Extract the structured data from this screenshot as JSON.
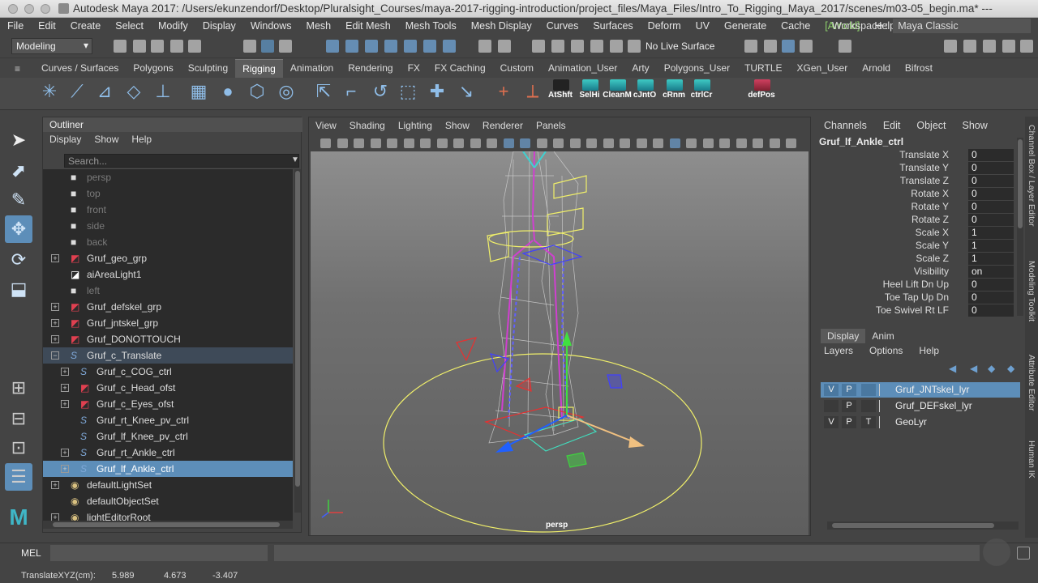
{
  "window": {
    "title": "Autodesk Maya 2017: /Users/ekunzendorf/Desktop/Pluralsight_Courses/maya-2017-rigging-introduction/project_files/Maya_Files/Intro_To_Rigging_Maya_2017/scenes/m03-05_begin.ma* ---"
  },
  "menu": [
    "File",
    "Edit",
    "Create",
    "Select",
    "Modify",
    "Display",
    "Windows",
    "Mesh",
    "Edit Mesh",
    "Mesh Tools",
    "Mesh Display",
    "Curves",
    "Surfaces",
    "Deform",
    "UV",
    "Generate",
    "Cache",
    "[Arnold]",
    "Help"
  ],
  "workspace": {
    "label": "Workspace :",
    "value": "Maya Classic"
  },
  "statusline": {
    "mode": "Modeling",
    "live_surface": "No Live Surface"
  },
  "shelf_tabs": [
    "Curves / Surfaces",
    "Polygons",
    "Sculpting",
    "Rigging",
    "Animation",
    "Rendering",
    "FX",
    "FX Caching",
    "Custom",
    "Animation_User",
    "Arty",
    "Polygons_User",
    "TURTLE",
    "XGen_User",
    "Arnold",
    "Bifrost"
  ],
  "shelf_active": "Rigging",
  "shelf_labels": [
    "AtShft",
    "SelHi",
    "CleanM",
    "cJntO",
    "cRnm",
    "ctrlCr",
    "defPos"
  ],
  "outliner": {
    "title": "Outliner",
    "menu": [
      "Display",
      "Show",
      "Help"
    ],
    "search_placeholder": "Search...",
    "items": [
      {
        "label": "persp",
        "indent": 0,
        "icon": "camera",
        "expand": false,
        "state": "grey"
      },
      {
        "label": "top",
        "indent": 0,
        "icon": "camera",
        "expand": false,
        "state": "grey"
      },
      {
        "label": "front",
        "indent": 0,
        "icon": "camera",
        "expand": false,
        "state": "grey"
      },
      {
        "label": "side",
        "indent": 0,
        "icon": "camera",
        "expand": false,
        "state": "grey"
      },
      {
        "label": "back",
        "indent": 0,
        "icon": "camera",
        "expand": false,
        "state": "grey"
      },
      {
        "label": "Gruf_geo_grp",
        "indent": 0,
        "icon": "group",
        "expand": true,
        "state": ""
      },
      {
        "label": "aiAreaLight1",
        "indent": 0,
        "icon": "light",
        "expand": false,
        "state": ""
      },
      {
        "label": "left",
        "indent": 0,
        "icon": "camera",
        "expand": false,
        "state": "grey"
      },
      {
        "label": "Gruf_defskel_grp",
        "indent": 0,
        "icon": "group",
        "expand": true,
        "state": ""
      },
      {
        "label": "Gruf_jntskel_grp",
        "indent": 0,
        "icon": "group",
        "expand": true,
        "state": ""
      },
      {
        "label": "Gruf_DONOTTOUCH",
        "indent": 0,
        "icon": "group",
        "expand": true,
        "state": ""
      },
      {
        "label": "Gruf_c_Translate",
        "indent": 0,
        "icon": "curve",
        "expand": "open",
        "state": "hilite"
      },
      {
        "label": "Gruf_c_COG_ctrl",
        "indent": 1,
        "icon": "curve",
        "expand": true,
        "state": ""
      },
      {
        "label": "Gruf_c_Head_ofst",
        "indent": 1,
        "icon": "group",
        "expand": true,
        "state": ""
      },
      {
        "label": "Gruf_c_Eyes_ofst",
        "indent": 1,
        "icon": "group",
        "expand": true,
        "state": ""
      },
      {
        "label": "Gruf_rt_Knee_pv_ctrl",
        "indent": 1,
        "icon": "curve",
        "expand": false,
        "state": ""
      },
      {
        "label": "Gruf_lf_Knee_pv_ctrl",
        "indent": 1,
        "icon": "curve",
        "expand": false,
        "state": ""
      },
      {
        "label": "Gruf_rt_Ankle_ctrl",
        "indent": 1,
        "icon": "curve",
        "expand": true,
        "state": ""
      },
      {
        "label": "Gruf_lf_Ankle_ctrl",
        "indent": 1,
        "icon": "curve",
        "expand": true,
        "state": "sel"
      },
      {
        "label": "defaultLightSet",
        "indent": 0,
        "icon": "set",
        "expand": true,
        "state": ""
      },
      {
        "label": "defaultObjectSet",
        "indent": 0,
        "icon": "set",
        "expand": false,
        "state": ""
      },
      {
        "label": "lightEditorRoot",
        "indent": 0,
        "icon": "set",
        "expand": true,
        "state": ""
      }
    ]
  },
  "viewport": {
    "menu": [
      "View",
      "Shading",
      "Lighting",
      "Show",
      "Renderer",
      "Panels"
    ],
    "camera": "persp"
  },
  "channel_box": {
    "menu": [
      "Channels",
      "Edit",
      "Object",
      "Show"
    ],
    "node": "Gruf_lf_Ankle_ctrl",
    "channels": [
      {
        "name": "Translate X",
        "value": "0"
      },
      {
        "name": "Translate Y",
        "value": "0"
      },
      {
        "name": "Translate Z",
        "value": "0"
      },
      {
        "name": "Rotate X",
        "value": "0"
      },
      {
        "name": "Rotate Y",
        "value": "0"
      },
      {
        "name": "Rotate Z",
        "value": "0"
      },
      {
        "name": "Scale X",
        "value": "1"
      },
      {
        "name": "Scale Y",
        "value": "1"
      },
      {
        "name": "Scale Z",
        "value": "1"
      },
      {
        "name": "Visibility",
        "value": "on"
      },
      {
        "name": "Heel Lift Dn Up",
        "value": "0"
      },
      {
        "name": "Toe Tap Up Dn",
        "value": "0"
      },
      {
        "name": "Toe Swivel Rt LF",
        "value": "0"
      }
    ]
  },
  "layer_editor": {
    "tabs": [
      "Display",
      "Anim"
    ],
    "menu": [
      "Layers",
      "Options",
      "Help"
    ],
    "layers": [
      {
        "v": "V",
        "p": "P",
        "t": "",
        "name": "Gruf_JNTskel_lyr",
        "selected": true
      },
      {
        "v": "",
        "p": "P",
        "t": "",
        "name": "Gruf_DEFskel_lyr",
        "selected": false
      },
      {
        "v": "V",
        "p": "P",
        "t": "T",
        "name": "GeoLyr",
        "selected": false
      }
    ]
  },
  "side_tabs": [
    "Channel Box / Layer Editor",
    "Modeling Toolkit",
    "Attribute Editor",
    "Human IK"
  ],
  "cmdline": {
    "label": "MEL"
  },
  "helpline": {
    "label": "TranslateXYZ(cm):",
    "x": "5.989",
    "y": "4.673",
    "z": "-3.407"
  },
  "colors": {
    "selection": "#5d8eb9",
    "panel": "#444444",
    "field": "#2b2b2b"
  }
}
